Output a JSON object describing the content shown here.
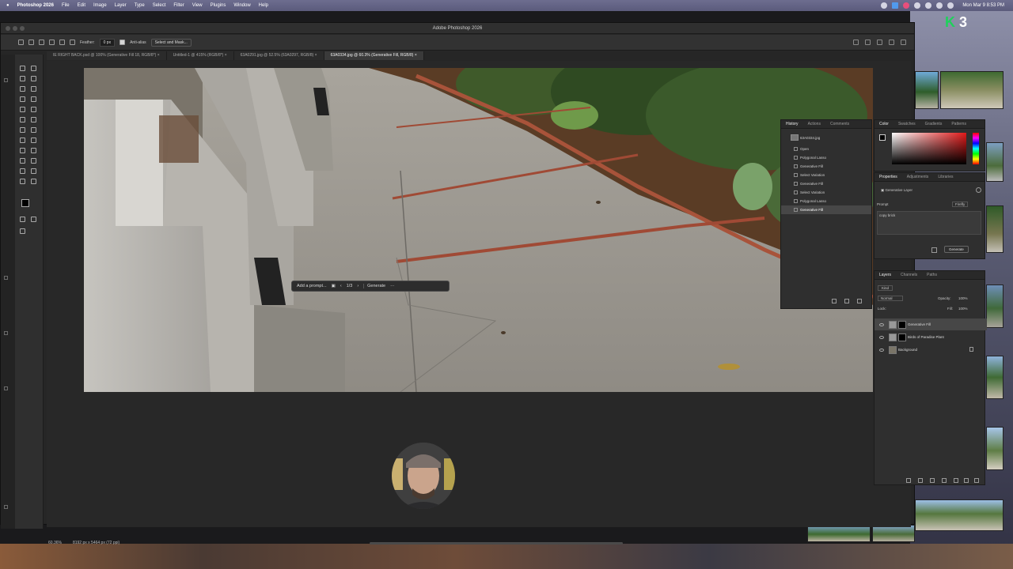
{
  "menubar": {
    "app": "Photoshop 2026",
    "items": [
      "File",
      "Edit",
      "Image",
      "Layer",
      "Type",
      "Select",
      "Filter",
      "View",
      "Plugins",
      "Window",
      "Help"
    ],
    "clock": "Mon Mar 9  8:53 PM"
  },
  "window": {
    "title": "Adobe Photoshop 2026"
  },
  "options": {
    "feather_label": "Feather:",
    "feather_value": "0 px",
    "antialias_label": "Anti-alias",
    "select_mask": "Select and Mask..."
  },
  "tabs": [
    "IE RIGHT BACK.psd @ 100% (Generative Fill 18, RGB/8*) ×",
    "Untitled-1 @ 415% (RGB/8*) ×",
    "63A0291.jpg @ 52.5% (63A0297, RGB/8) ×",
    "63A0334.jpg @ 60.3% (Generative Fill, RGB/8) ×"
  ],
  "gen_bar": {
    "prompt": "Add a prompt...",
    "counter": "1/3",
    "generate": "Generate",
    "more": "···"
  },
  "history": {
    "tabs": [
      "History",
      "Actions",
      "Comments"
    ],
    "snapshot": "63A0334.jpg",
    "items": [
      "Open",
      "Polygonal Lasso",
      "Generative Fill",
      "Select Variation",
      "Generative Fill",
      "Select Variation",
      "Polygonal Lasso",
      "Generative Fill"
    ]
  },
  "color_panel": {
    "tabs": [
      "Color",
      "Swatches",
      "Gradients",
      "Patterns"
    ],
    "hue_color": "#e01919"
  },
  "properties": {
    "tabs": [
      "Properties",
      "Adjustments",
      "Libraries"
    ],
    "layer_type": "Generative Layer",
    "prompt_label": "Prompt",
    "model": "Firefly",
    "prompt_text": "copy brick",
    "generate": "Generate"
  },
  "layers": {
    "tabs": [
      "Layers",
      "Channels",
      "Paths"
    ],
    "kind": "Kind",
    "blend": "Normal",
    "opacity_label": "Opacity:",
    "opacity": "100%",
    "lock_label": "Lock:",
    "fill_label": "Fill:",
    "fill": "100%",
    "items": [
      {
        "name": "Generative Fill",
        "selected": true
      },
      {
        "name": "Birds of Paradise Plant",
        "selected": false
      },
      {
        "name": "Background",
        "selected": false
      }
    ]
  },
  "status": {
    "zoom": "60.36%",
    "doc": "8192 px x 5464 px (72 ppi)"
  },
  "desktop": {
    "badge_letter": "K",
    "badge_number": "3"
  }
}
